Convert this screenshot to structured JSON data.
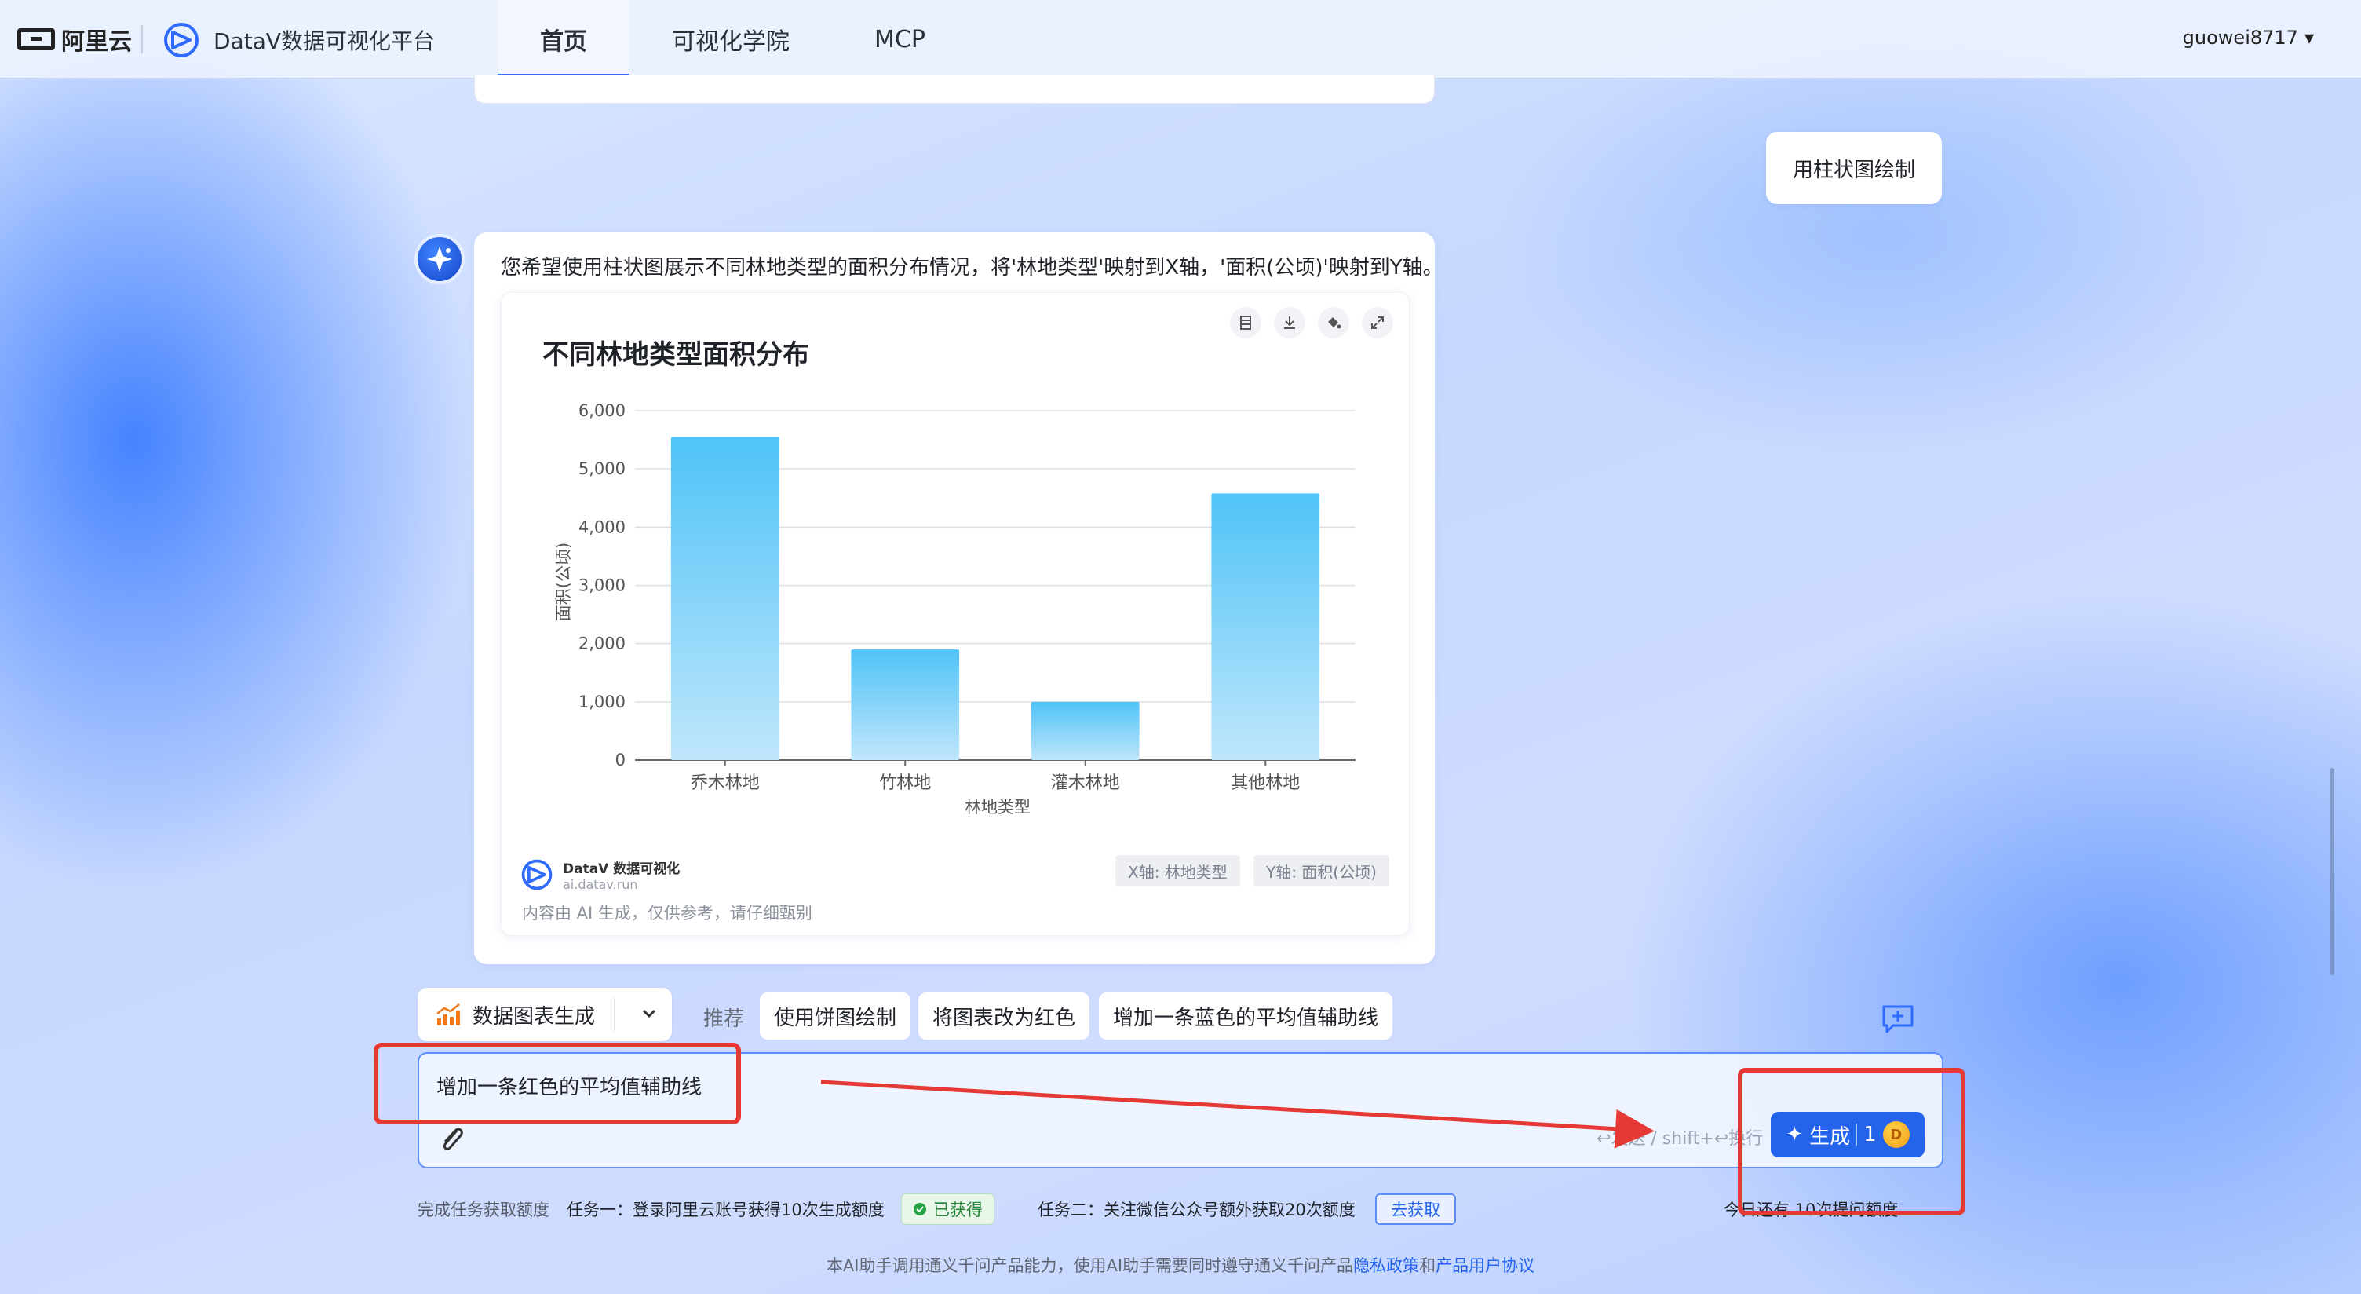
{
  "header": {
    "logo_text": "阿里云",
    "brand": "DataV数据可视化平台",
    "nav": [
      "首页",
      "可视化学院",
      "MCP"
    ],
    "active_nav": "首页",
    "user": "guowei8717"
  },
  "conversation": {
    "user_message": "用柱状图绘制",
    "bot_message": "您希望使用柱状图展示不同林地类型的面积分布情况，将'林地类型'映射到X轴，'面积(公顷)'映射到Y轴。",
    "chart_footer": {
      "brand": "DataV 数据可视化",
      "url": "ai.datav.run",
      "x_chip": "X轴: 林地类型",
      "y_chip": "Y轴: 面积(公顷)",
      "disclaimer": "内容由 AI 生成，仅供参考，请仔细甄别"
    }
  },
  "chart_data": {
    "type": "bar",
    "title": "不同林地类型面积分布",
    "categories": [
      "乔木林地",
      "竹林地",
      "灌木林地",
      "其他林地"
    ],
    "values": [
      5550,
      1900,
      1000,
      4580
    ],
    "xlabel": "林地类型",
    "ylabel": "面积(公顷)",
    "ylim": [
      0,
      6000
    ],
    "yticks": [
      "0",
      "1,000",
      "2,000",
      "3,000",
      "4,000",
      "5,000",
      "6,000"
    ],
    "grid": true,
    "colors": {
      "bar_top": "#4fc3f7",
      "bar_bottom": "#bfe6fb"
    }
  },
  "composer": {
    "mode": "数据图表生成",
    "recommend_label": "推荐",
    "suggestions": [
      "使用饼图绘制",
      "将图表改为红色",
      "增加一条蓝色的平均值辅助线"
    ],
    "input_value": "增加一条红色的平均值辅助线",
    "hint": "↩发送 / shift+↩换行",
    "generate_label": "生成",
    "generate_cost": "1"
  },
  "tasks": {
    "label": "完成任务获取额度",
    "task1": "任务一：登录阿里云账号获得10次生成额度",
    "task1_status": "已获得",
    "task2": "任务二：关注微信公众号额外获取20次额度",
    "task2_action": "去获取",
    "quota": "今日还有 10次提问额度"
  },
  "footer": {
    "note_prefix": "本AI助手调用通义千问产品能力，使用AI助手需要同时遵守通义千问产品",
    "privacy": "隐私政策",
    "and": "和",
    "agreement": "产品用户协议"
  },
  "accent_color": "#2463eb"
}
